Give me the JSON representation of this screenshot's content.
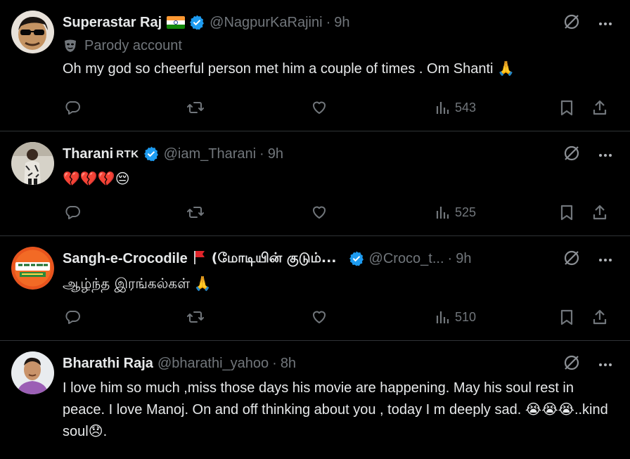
{
  "tweets": [
    {
      "name": "Superastar Raj",
      "handle": "@NagpurKaRajini",
      "time": "9h",
      "parody_label": "Parody account",
      "text": "Oh my god so cheerful person met him a couple of times . Om Shanti",
      "text_emoji": "🙏",
      "views": "543",
      "icons": [
        "flag-india-icon",
        "verified-icon",
        "grok-icon",
        "more-icon",
        "mask-icon"
      ]
    },
    {
      "name": "Tharani",
      "name_badge": "RTK",
      "handle": "@iam_Tharani",
      "time": "9h",
      "text_emoji": "💔💔💔😔",
      "views": "525"
    },
    {
      "name": "Sangh-e-Crocodile",
      "name_tamil": "(மோடியின் குடும்...",
      "handle": "@Croco_t...",
      "time": "9h",
      "text": "ஆழ்ந்த இரங்கல்கள்",
      "text_emoji": "🙏",
      "views": "510"
    },
    {
      "name": "Bharathi Raja",
      "handle": "@bharathi_yahoo",
      "time": "8h",
      "text": "I love him so much ,miss those days his movie are happening. May his soul rest in peace. I love Manoj. On and off thinking about you , today I m deeply sad.",
      "text_emoji": "😭😭😭",
      "text_tail": "..kind soul",
      "text_tail_emoji": "😞",
      "text_end": "."
    }
  ],
  "colors": {
    "background": "#000000",
    "text": "#e7e9ea",
    "secondary": "#71767b",
    "verified": "#1d9bf0",
    "divider": "#2f3336"
  }
}
